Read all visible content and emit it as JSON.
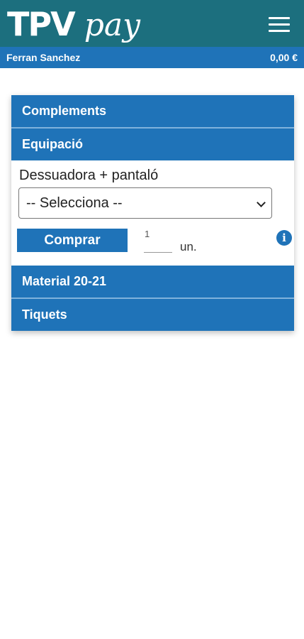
{
  "header": {
    "logo_main": "TPV",
    "logo_sub": "pay",
    "menu_icon": "hamburger-menu-icon"
  },
  "user": {
    "name": "Ferran Sanchez",
    "balance": "0,00 €"
  },
  "categories": [
    {
      "label": "Complements"
    },
    {
      "label": "Equipació"
    },
    {
      "label": "Material 20-21"
    },
    {
      "label": "Tiquets"
    }
  ],
  "product": {
    "name": "Dessuadora + pantaló",
    "select_value": "-- Selecciona --",
    "buy_label": "Comprar",
    "quantity": "1",
    "unit": "un.",
    "info_icon": "info-icon"
  },
  "colors": {
    "topbar": "#1c6f7e",
    "accent": "#1f73b8"
  }
}
